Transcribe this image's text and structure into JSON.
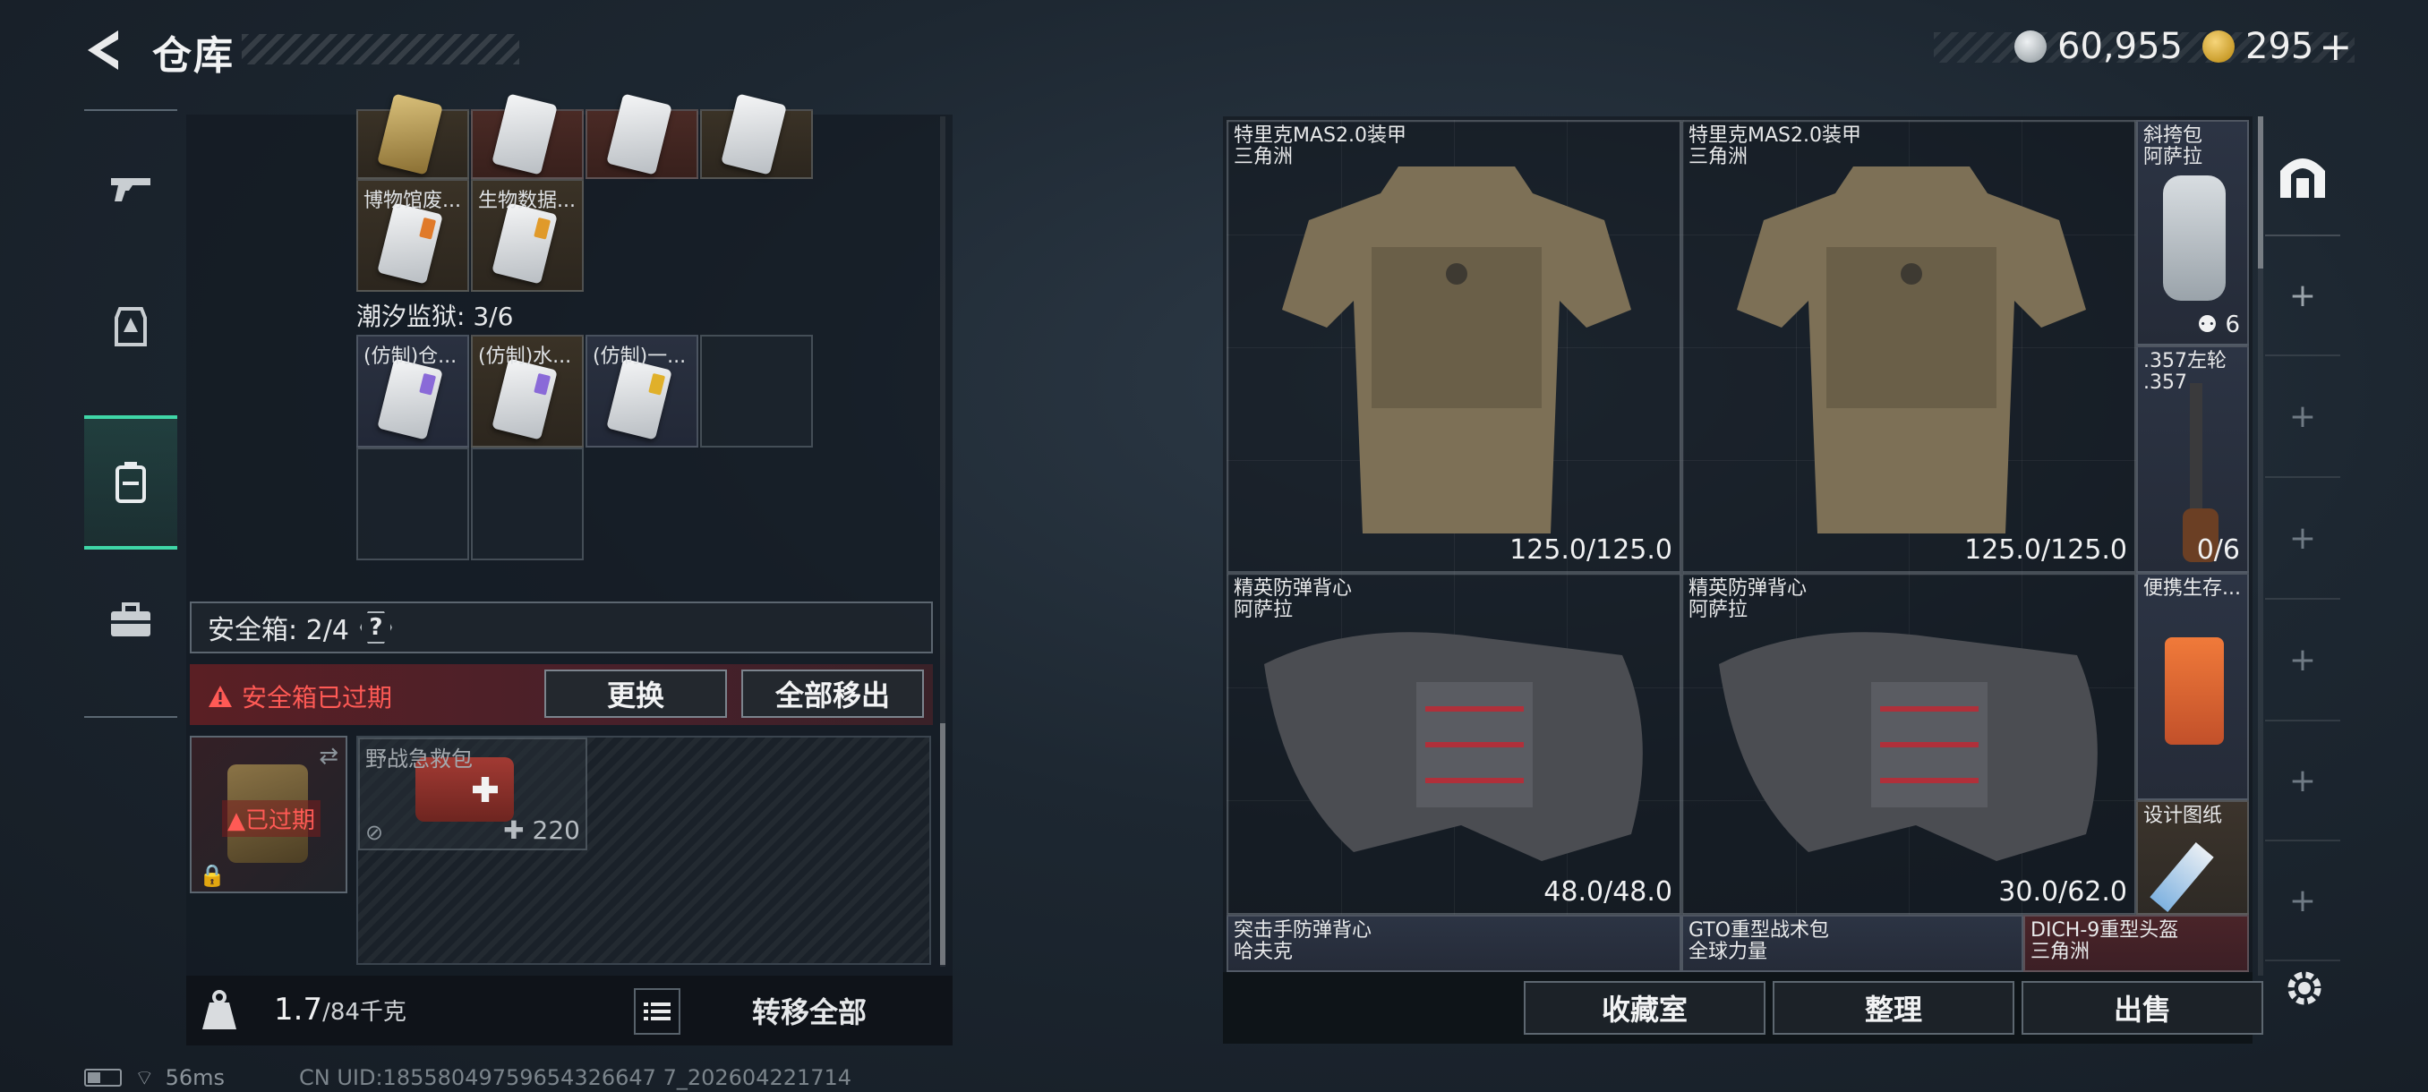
{
  "header": {
    "title": "仓库",
    "currency_silver": "60,955",
    "currency_gold": "295",
    "currency_gold_plus": "+"
  },
  "left_panel": {
    "top_row_items": [
      "",
      "",
      "",
      ""
    ],
    "row2_items": [
      "博物馆废...",
      "生物数据..."
    ],
    "zone_label": "潮汐监狱: 3/6",
    "zone_items": [
      "(仿制)仓...",
      "(仿制)水...",
      "(仿制)一..."
    ],
    "safebox_label": "安全箱: 2/4",
    "safebox_help": "?",
    "expired_warning": "安全箱已过期",
    "btn_replace": "更换",
    "btn_move_all": "全部移出",
    "case_expired": "已过期",
    "medkit_name": "野战急救包",
    "medkit_value": "220",
    "weight_current": "1.7",
    "weight_max": "/84千克",
    "transfer_all": "转移全部"
  },
  "stash": {
    "items": [
      {
        "name": "特里克MAS2.0装甲",
        "sub": "三角洲",
        "durability": "125.0/125.0"
      },
      {
        "name": "特里克MAS2.0装甲",
        "sub": "三角洲",
        "durability": "125.0/125.0"
      },
      {
        "name": "斜挎包",
        "sub": "阿萨拉",
        "count": "6"
      },
      {
        "name": ".357左轮",
        "sub": ".357",
        "ammo": "0/6"
      },
      {
        "name": "精英防弹背心",
        "sub": "阿萨拉",
        "durability": "48.0/48.0"
      },
      {
        "name": "精英防弹背心",
        "sub": "阿萨拉",
        "durability": "30.0/62.0"
      },
      {
        "name": "便携生存...",
        "sub": ""
      },
      {
        "name": "设计图纸",
        "sub": ""
      },
      {
        "name": "突击手防弹背心",
        "sub": "哈夫克"
      },
      {
        "name": "GTO重型战术包",
        "sub": "全球力量"
      },
      {
        "name": "DICH-9重型头盔",
        "sub": "三角洲"
      }
    ],
    "btn_collection": "收藏室",
    "btn_sort": "整理",
    "btn_sell": "出售"
  },
  "status_bar": {
    "ping": "56ms",
    "uid": "CN UID:18558049759654326647 7_202604221714"
  },
  "colors": {
    "accent_green": "#3fd6a7",
    "warning_red": "#ff5a55"
  }
}
